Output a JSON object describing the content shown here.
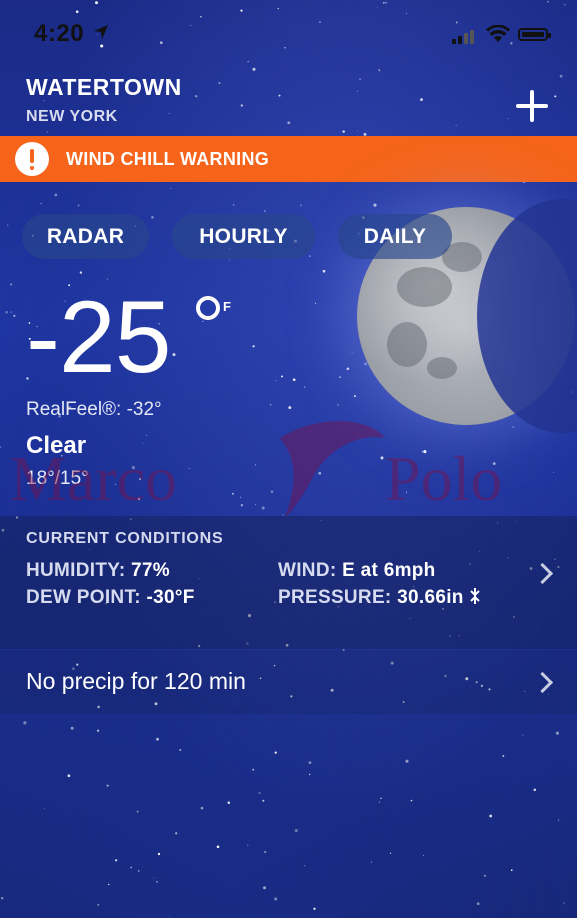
{
  "status_bar": {
    "time": "4:20"
  },
  "location": {
    "city": "WATERTOWN",
    "state": "NEW YORK"
  },
  "alert": {
    "text": "WIND CHILL WARNING",
    "color": "#f5641a"
  },
  "tabs": [
    {
      "label": "RADAR"
    },
    {
      "label": "HOURLY"
    },
    {
      "label": "DAILY"
    }
  ],
  "current": {
    "temperature": "-25",
    "unit": "F",
    "realfeel": "RealFeel®: -32°",
    "condition": "Clear",
    "hi_lo": "18°/15°"
  },
  "watermark": "Marco Polo",
  "conditions": {
    "title": "CURRENT CONDITIONS",
    "humidity_label": "HUMIDITY:",
    "humidity_value": "77%",
    "dew_point_label": "DEW POINT:",
    "dew_point_value": "-30°F",
    "wind_label": "WIND:",
    "wind_value": "E at 6mph",
    "pressure_label": "PRESSURE:",
    "pressure_value": "30.66in"
  },
  "precip": {
    "text": "No precip for 120 min"
  },
  "icons": [
    "location-arrow-icon",
    "signal-icon",
    "wifi-icon",
    "battery-icon",
    "plus-icon",
    "alert-icon",
    "moon-icon",
    "chevron-right-icon",
    "pressure-steady-icon"
  ]
}
